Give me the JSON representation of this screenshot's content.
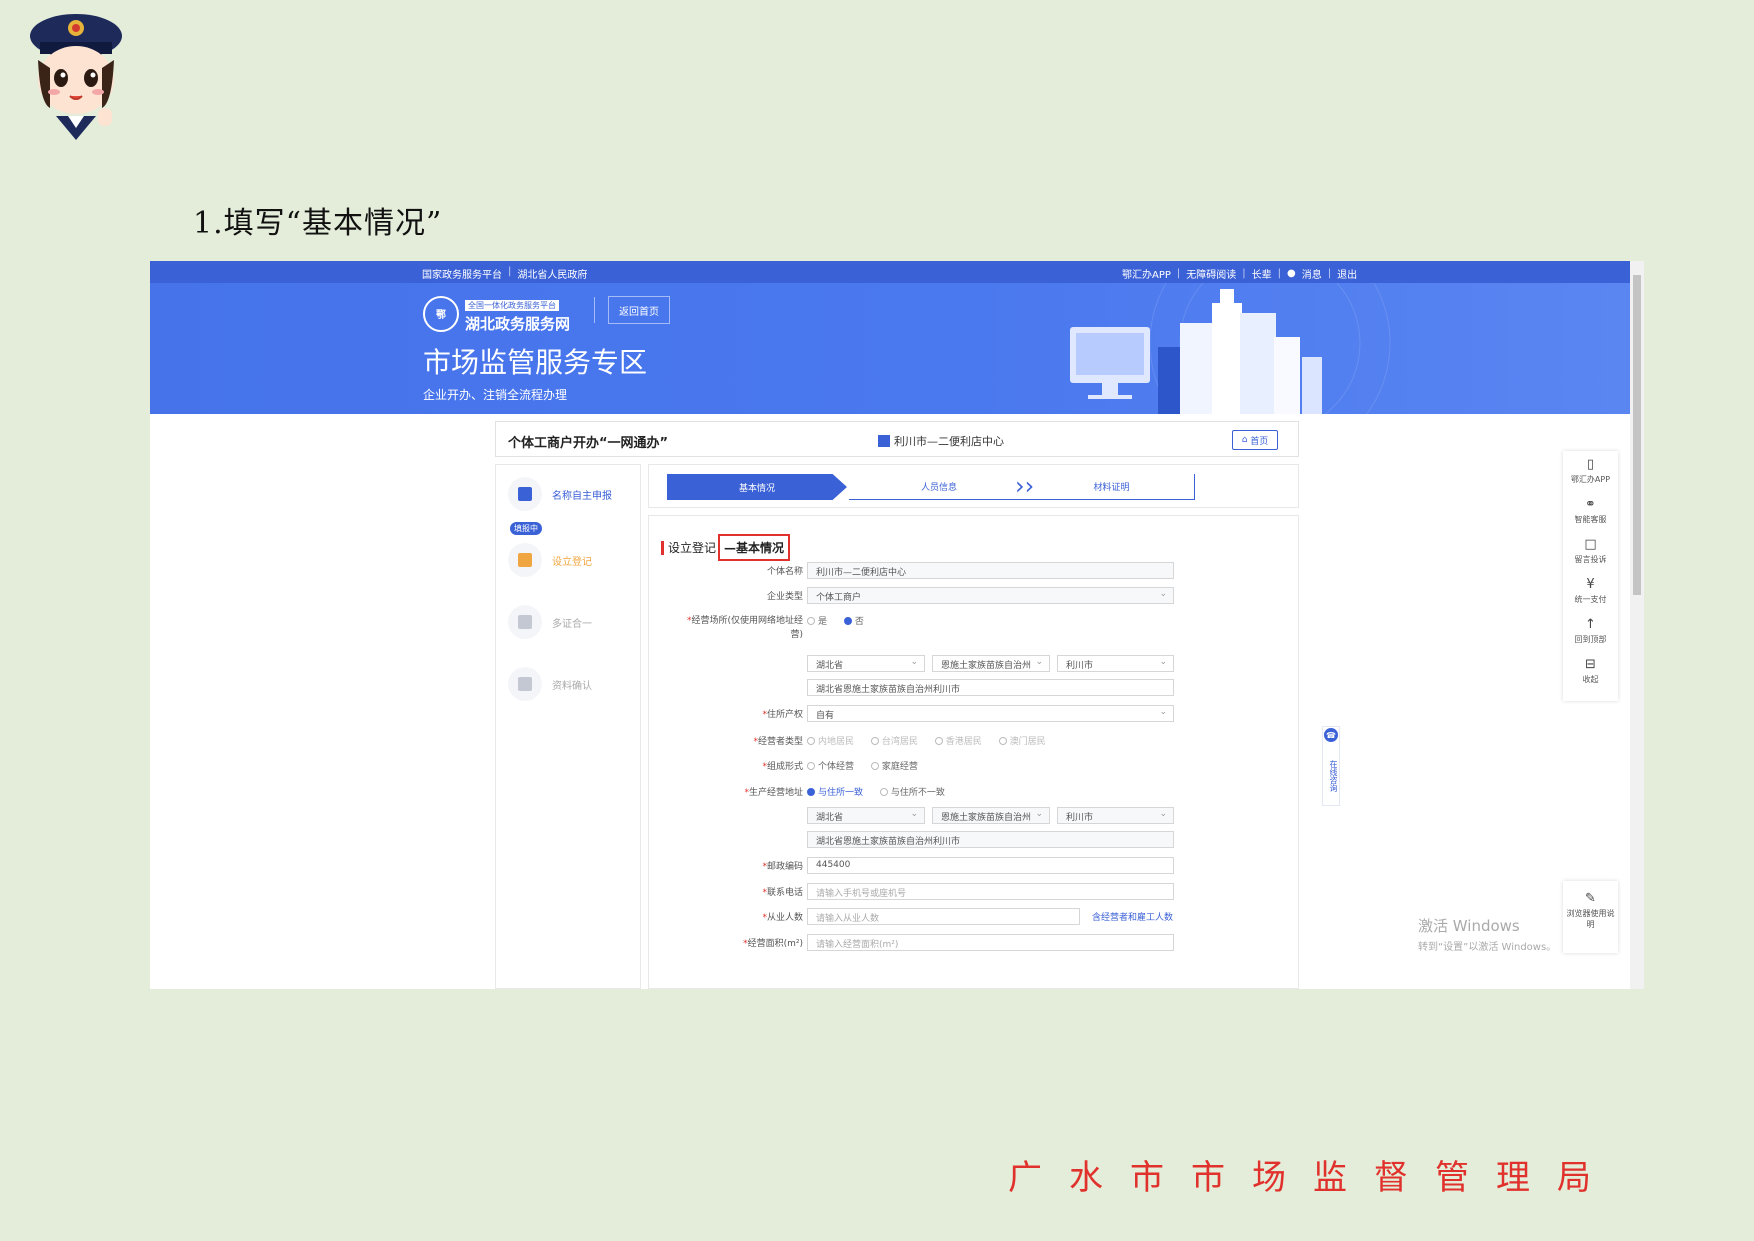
{
  "slide": {
    "title": "1.填写“基本情况”",
    "footer_org": "广水市市场监督管理局"
  },
  "portal": {
    "topbar_left": [
      "国家政务服务平台",
      "湖北省人民政府"
    ],
    "topbar_right": [
      "鄂汇办APP",
      "无障碍阅读",
      "长辈",
      "消息",
      "退出"
    ],
    "logo_small": "全国一体化政务服务平台",
    "logo_big": "湖北政务服务网",
    "back_home": "返回首页",
    "zone_title": "市场监管服务专区",
    "zone_subtitle": "企业开办、注销全流程办理"
  },
  "header_card": {
    "title": "个体工商户开办“一网通办”",
    "center_label": "利川市—二便利店中心",
    "home_button": "首页"
  },
  "left_steps": [
    {
      "label": "名称自主申报",
      "state": "active"
    },
    {
      "label": "设立登记",
      "state": "current"
    },
    {
      "label": "多证合一",
      "state": "pending"
    },
    {
      "label": "资料确认",
      "state": "pending"
    }
  ],
  "badge_doing": "填报中",
  "progress_steps": [
    "基本情况",
    "人员信息",
    "材料证明"
  ],
  "form": {
    "section_prefix": "设立登记",
    "section_highlight": "—基本情况",
    "name_label": "个体名称",
    "name_value": "利川市—二便利店中心",
    "type_label": "企业类型",
    "type_value": "个体工商户",
    "premise_label": "经营场所(仅使用网络地址经营)",
    "premise_yes": "是",
    "premise_no": "否",
    "province_1": "湖北省",
    "prefecture_1": "恩施土家族苗族自治州",
    "city_1": "利川市",
    "address_1": "湖北省恩施土家族苗族自治州利川市",
    "property_label": "住所产权",
    "property_value": "自有",
    "operator_type_label": "经营者类型",
    "operator_types": [
      "内地居民",
      "台湾居民",
      "香港居民",
      "澳门居民"
    ],
    "form_label": "组成形式",
    "form_options": [
      "个体经营",
      "家庭经营"
    ],
    "prod_addr_label": "生产经营地址",
    "prod_addr_options": [
      "与住所一致",
      "与住所不一致"
    ],
    "province_2": "湖北省",
    "prefecture_2": "恩施土家族苗族自治州",
    "city_2": "利川市",
    "address_2": "湖北省恩施土家族苗族自治州利川市",
    "postcode_label": "邮政编码",
    "postcode_value": "445400",
    "phone_label": "联系电话",
    "phone_placeholder": "请输入手机号或座机号",
    "staff_label": "从业人数",
    "staff_placeholder": "请输入从业人数",
    "staff_link": "含经营者和雇工人数",
    "next_label": "经营面积(m²)",
    "next_placeholder": "请输入经营面积(m²)"
  },
  "float_bar": [
    "鄂汇办APP",
    "智能客服",
    "留言投诉",
    "统一支付",
    "回到顶部",
    "收起"
  ],
  "float_bottom": "浏览器使用说明",
  "consult": "在线咨询",
  "watermark": {
    "line1": "激活 Windows",
    "line2": "转到“设置”以激活 Windows。"
  }
}
